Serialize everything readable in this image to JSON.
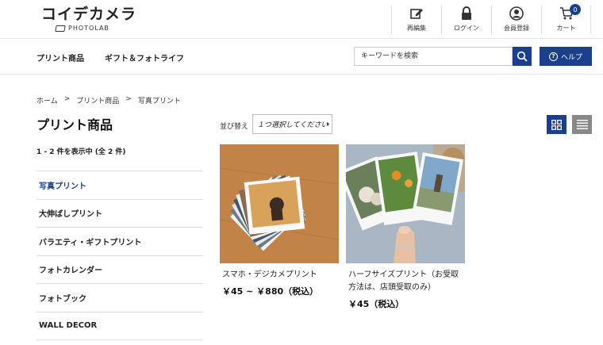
{
  "header": {
    "logo_main": "コイデカメラ",
    "logo_sub": "PHOTOLAB",
    "util_nav": [
      {
        "label": "再編集",
        "icon": "edit-icon"
      },
      {
        "label": "ログイン",
        "icon": "lock-icon"
      },
      {
        "label": "会員登録",
        "icon": "user-icon"
      },
      {
        "label": "カート",
        "icon": "cart-icon"
      }
    ],
    "cart_count": "0"
  },
  "main_nav": {
    "items": [
      "プリント商品",
      "ギフト＆フォトライフ"
    ],
    "search_placeholder": "キーワードを検索",
    "help_label": "ヘルプ",
    "help_glyph": "?"
  },
  "breadcrumb": {
    "items": [
      "ホーム",
      "プリント商品",
      "写真プリント"
    ],
    "separator": ">"
  },
  "page": {
    "title": "プリント商品",
    "result_count": "1 - 2 件を表示中 (全 2 件)"
  },
  "categories": [
    {
      "label": "写真プリント",
      "active": true
    },
    {
      "label": "大伸ばしプリント",
      "active": false
    },
    {
      "label": "バラエティ・ギフトプリント",
      "active": false
    },
    {
      "label": "フォトカレンダー",
      "active": false
    },
    {
      "label": "フォトブック",
      "active": false
    },
    {
      "label": "WALL DECOR",
      "active": false
    }
  ],
  "sort": {
    "label": "並び替え",
    "selected": "１つ選択してください",
    "caret": "▾"
  },
  "products": [
    {
      "name": "スマホ・デジカメプリント",
      "price": "￥45 ~ ￥880（税込）"
    },
    {
      "name": "ハーフサイズプリント（お受取方法は、店頭受取のみ）",
      "price": "￥45（税込）"
    }
  ],
  "colors": {
    "accent": "#1a3f8f",
    "list_view": "#888888"
  }
}
